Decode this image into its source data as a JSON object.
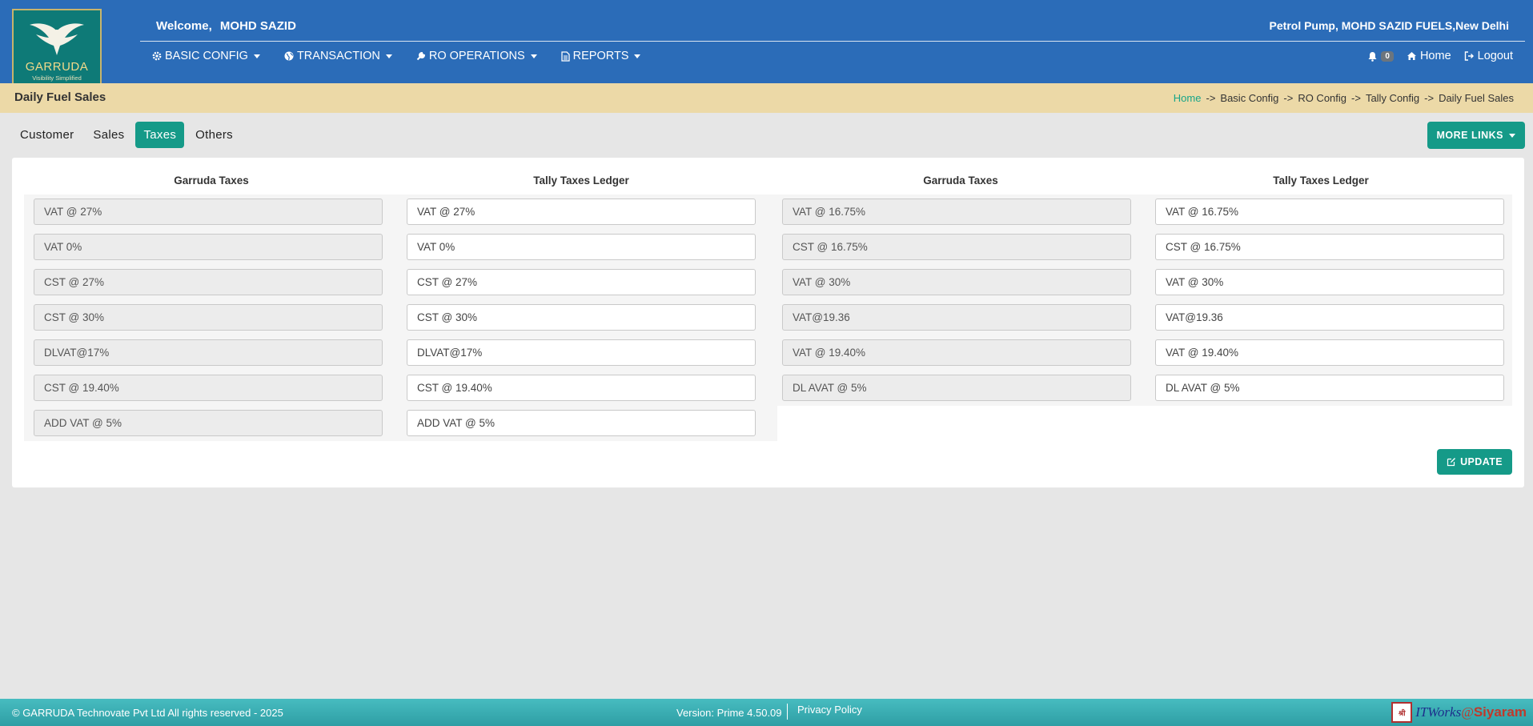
{
  "header": {
    "logo_name": "GARRUDA",
    "logo_tagline": "Visibility Simplified",
    "welcome_label": "Welcome,",
    "user_name": "MOHD SAZID",
    "pump_info": "Petrol Pump, MOHD SAZID FUELS,New Delhi",
    "menu": [
      {
        "label": "BASIC CONFIG",
        "icon": "gear-icon"
      },
      {
        "label": "TRANSACTION",
        "icon": "globe-icon"
      },
      {
        "label": "RO OPERATIONS",
        "icon": "wrench-icon"
      },
      {
        "label": "REPORTS",
        "icon": "document-icon"
      }
    ],
    "notification_count": "0",
    "home_label": "Home",
    "logout_label": "Logout"
  },
  "titlebar": {
    "page_title": "Daily Fuel Sales",
    "breadcrumb": [
      "Home",
      "Basic Config",
      "RO Config",
      "Tally Config",
      "Daily Fuel Sales"
    ],
    "separator": "->"
  },
  "tabs": [
    {
      "label": "Customer",
      "active": false
    },
    {
      "label": "Sales",
      "active": false
    },
    {
      "label": "Taxes",
      "active": true
    },
    {
      "label": "Others",
      "active": false
    }
  ],
  "more_links_label": "MORE LINKS",
  "columns": {
    "garruda_header": "Garruda Taxes",
    "tally_header": "Tally Taxes Ledger"
  },
  "left_rows": [
    {
      "garruda": "VAT @ 27%",
      "tally": "VAT @ 27%"
    },
    {
      "garruda": "VAT 0%",
      "tally": "VAT 0%"
    },
    {
      "garruda": "CST @ 27%",
      "tally": "CST @ 27%"
    },
    {
      "garruda": "CST @ 30%",
      "tally": "CST @ 30%"
    },
    {
      "garruda": "DLVAT@17%",
      "tally": "DLVAT@17%"
    },
    {
      "garruda": "CST @ 19.40%",
      "tally": "CST @ 19.40%"
    },
    {
      "garruda": "ADD VAT @ 5%",
      "tally": "ADD VAT @ 5%"
    }
  ],
  "right_rows": [
    {
      "garruda": "VAT @ 16.75%",
      "tally": "VAT @ 16.75%"
    },
    {
      "garruda": "CST @ 16.75%",
      "tally": "CST @ 16.75%"
    },
    {
      "garruda": "VAT @ 30%",
      "tally": "VAT @ 30%"
    },
    {
      "garruda": "VAT@19.36",
      "tally": "VAT@19.36"
    },
    {
      "garruda": "VAT @ 19.40%",
      "tally": "VAT @ 19.40%"
    },
    {
      "garruda": "DL AVAT @ 5%",
      "tally": "DL AVAT @ 5%"
    }
  ],
  "update_label": "UPDATE",
  "footer": {
    "copyright": "© GARRUDA Technovate Pvt Ltd All rights reserved - 2025",
    "version": "Version: Prime 4.50.09",
    "privacy": "Privacy Policy",
    "brand_mark": "SIYARAM",
    "brand_it": "ITWorks",
    "brand_at": "@",
    "brand_siyaram": "Siyaram"
  },
  "colors": {
    "header_blue": "#2b6cb8",
    "title_bar": "#ecd9a7",
    "accent_teal": "#159a88",
    "footer_teal": "#3aaeb2"
  }
}
